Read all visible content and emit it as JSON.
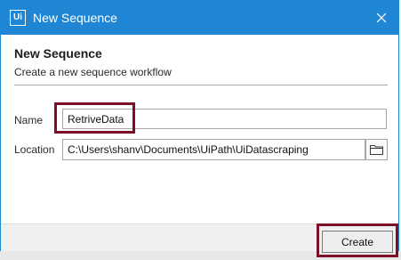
{
  "window": {
    "app_icon_text": "Ui",
    "title": "New Sequence"
  },
  "header": {
    "heading": "New Sequence",
    "subheading": "Create a new sequence workflow"
  },
  "form": {
    "name_label": "Name",
    "name_value": "RetriveData",
    "location_label": "Location",
    "location_value": "C:\\Users\\shanv\\Documents\\UiPath\\UiDatascraping"
  },
  "footer": {
    "create_label": "Create"
  },
  "colors": {
    "titlebar": "#1f86d6",
    "highlight": "#7d1026"
  },
  "icons": {
    "close": "close-icon",
    "browse": "folder-icon"
  }
}
